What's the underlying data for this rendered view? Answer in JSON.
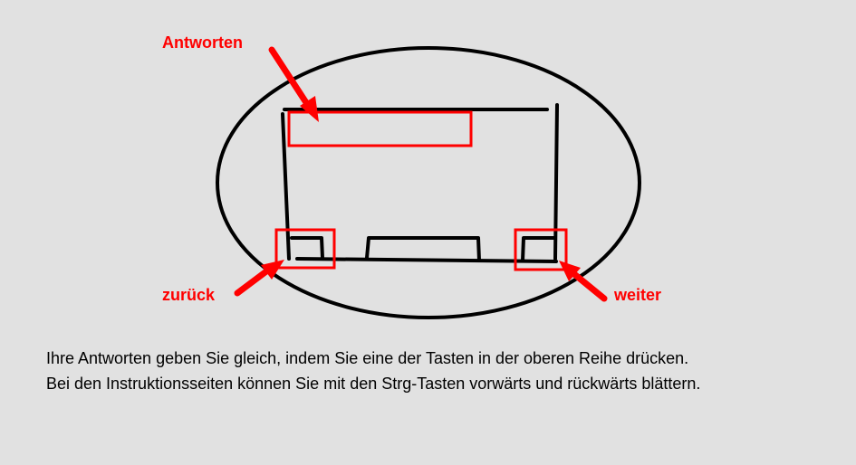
{
  "colors": {
    "background": "#e1e1e1",
    "sketch": "#000000",
    "highlight": "#ff0000"
  },
  "labels": {
    "answers": "Antworten",
    "back": "zurück",
    "next": "weiter"
  },
  "instructions": {
    "line1": "Ihre Antworten geben Sie gleich, indem Sie eine der Tasten in der oberen Reihe drücken.",
    "line2": "Bei den Instruktionsseiten können Sie mit den Strg-Tasten vorwärts und rückwärts blättern."
  }
}
